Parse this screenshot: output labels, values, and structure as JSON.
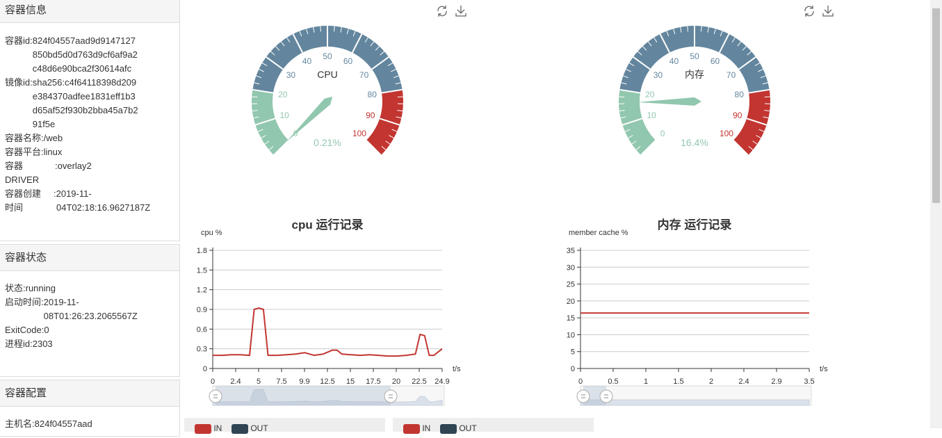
{
  "container_info": {
    "title": "容器信息",
    "id_label": "容器id:",
    "id_value": "824f04557aad9d9147127850bd5d0d763d9cf6af9a2c48d6e90bca2f30614afc",
    "id_lines": [
      "824f04557aad9d9147127",
      "850bd5d0d763d9cf6af9a2",
      "c48d6e90bca2f30614afc"
    ],
    "image_label": "镜像id:",
    "image_lines": [
      "sha256:c4f64118398d209",
      "e384370adfee1831eff1b3",
      "d65af52f930b2bba45a7b2",
      "91f5e"
    ],
    "name_label": "容器名称:",
    "name_value": "/web",
    "platform_label": "容器平台:",
    "platform_value": "linux",
    "driver_label_1": "容器",
    "driver_label_2": "DRIVER",
    "driver_value": ":overlay2",
    "created_label_1": "容器创建",
    "created_label_2": "时间",
    "created_value_1": ":2019-11-",
    "created_value_2": "04T02:18:16.9627187Z"
  },
  "container_state": {
    "title": "容器状态",
    "status_label": "状态:",
    "status_value": "running",
    "started_label": "启动时间:",
    "started_value_1": "2019-11-",
    "started_value_2": "08T01:26:23.2065567Z",
    "exit_label": "ExitCode:",
    "exit_value": "0",
    "pid_label": "进程id:",
    "pid_value": "2303"
  },
  "container_config": {
    "title": "容器配置",
    "host_label": "主机名:",
    "host_value": "824f04557aad"
  },
  "gauges": [
    {
      "name": "CPU",
      "value": 0.21,
      "display": "0.21%",
      "ticks": [
        "0",
        "10",
        "20",
        "30",
        "40",
        "50",
        "60",
        "70",
        "80",
        "90",
        "100"
      ]
    },
    {
      "name": "内存",
      "value": 16.4,
      "display": "16.4%",
      "ticks": [
        "0",
        "10",
        "20",
        "30",
        "40",
        "50",
        "60",
        "70",
        "80",
        "90",
        "100"
      ]
    }
  ],
  "colors": {
    "green": "#91c7ae",
    "blue": "#63869e",
    "red": "#c23531",
    "line": "#c23531"
  },
  "icons": {
    "refresh": "refresh-icon",
    "download": "download-icon"
  },
  "chart_data": [
    {
      "type": "line",
      "title": "cpu 运行记录",
      "ylabel": "cpu %",
      "xlabel": "t/s",
      "x_ticks": [
        "0",
        "2.4",
        "5",
        "7.5",
        "9.9",
        "12.5",
        "15",
        "17.5",
        "20",
        "22.5",
        "24.9"
      ],
      "y_ticks": [
        "0",
        "0.3",
        "0.6",
        "0.9",
        "1.2",
        "1.5",
        "1.8"
      ],
      "ylim": [
        0,
        1.8
      ],
      "xlim": [
        0,
        24.9
      ],
      "series": [
        {
          "name": "",
          "x": [
            0,
            1,
            2,
            3,
            4,
            4.5,
            5,
            5.5,
            6,
            7,
            8,
            9,
            10,
            11,
            12,
            13,
            13.5,
            14,
            15,
            16,
            17,
            18,
            19,
            20,
            21,
            22,
            22.5,
            23,
            23.5,
            24,
            24.9
          ],
          "values": [
            0.2,
            0.2,
            0.21,
            0.21,
            0.2,
            0.9,
            0.92,
            0.9,
            0.2,
            0.2,
            0.21,
            0.22,
            0.24,
            0.2,
            0.22,
            0.28,
            0.28,
            0.22,
            0.21,
            0.2,
            0.21,
            0.2,
            0.19,
            0.19,
            0.2,
            0.22,
            0.52,
            0.5,
            0.2,
            0.2,
            0.3
          ]
        }
      ],
      "grid": true
    },
    {
      "type": "line",
      "title": "内存 运行记录",
      "ylabel": "member cache %",
      "xlabel": "t/s",
      "x_ticks": [
        "0",
        "0.5",
        "1",
        "1.5",
        "2",
        "2.4",
        "2.9",
        "3.5"
      ],
      "y_ticks": [
        "0",
        "5",
        "10",
        "15",
        "20",
        "25",
        "30",
        "35"
      ],
      "ylim": [
        0,
        35
      ],
      "xlim": [
        0,
        3.5
      ],
      "series": [
        {
          "name": "",
          "x": [
            0,
            3.5
          ],
          "values": [
            16.4,
            16.4
          ]
        }
      ],
      "grid": true
    }
  ],
  "legends": [
    {
      "in": "IN",
      "out": "OUT"
    },
    {
      "in": "IN",
      "out": "OUT"
    }
  ]
}
